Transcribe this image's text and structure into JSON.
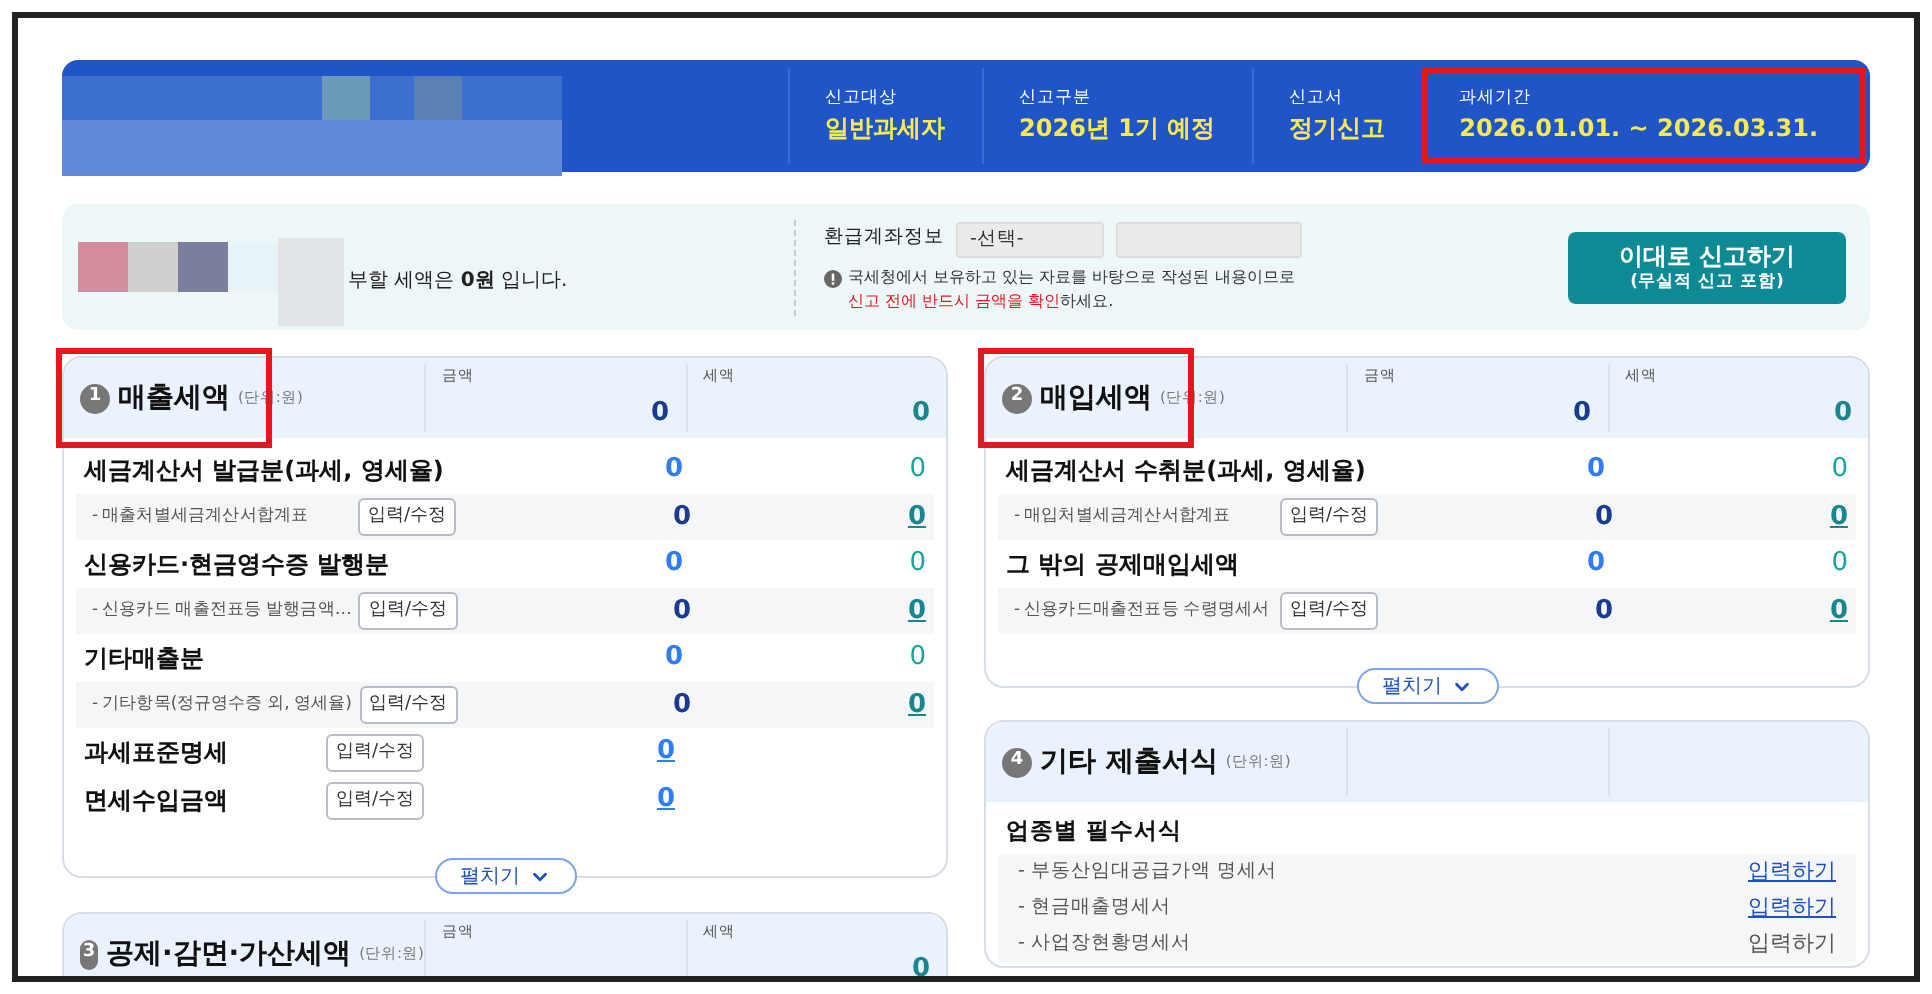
{
  "header": {
    "items": [
      {
        "label": "신고대상",
        "value": "일반과세자",
        "highlighted": false
      },
      {
        "label": "신고구분",
        "value": "2026년 1기 예정",
        "highlighted": false
      },
      {
        "label": "신고서",
        "value": "정기신고",
        "highlighted": false
      },
      {
        "label": "과세기간",
        "value": "2026.01.01. ~ 2026.03.31.",
        "highlighted": true
      }
    ]
  },
  "summary": {
    "message": "부할 세액은 **0원** 입니다.",
    "refund_label": "환급계좌정보",
    "bank_select": "-선택-",
    "notice_line1": "국세청에서 보유하고 있는 자료를 바탕으로 작성된 내용이므로",
    "notice_warning": "신고 전에 반드시 금액을 확인",
    "notice_tail": "하세요.",
    "submit_button": "이대로 신고하기",
    "submit_sub": "(무실적 신고 포함)"
  },
  "left_sections": [
    {
      "number": "1",
      "title": "매출세액",
      "unit": "(단위:원)",
      "highlighted": true,
      "amount_label": "금액",
      "amount": "0",
      "tax_label": "세액",
      "tax": "0",
      "expand_button": "펼치기",
      "rows": [
        {
          "kind": "main",
          "label": "세금계산서 발급분(과세, 영세율)",
          "amount": "0",
          "tax": "0"
        },
        {
          "kind": "sub",
          "label": "- 매출처별세금계산서합계표",
          "button": "입력/수정",
          "amount": "0",
          "tax": "0"
        },
        {
          "kind": "main",
          "label": "신용카드·현금영수증 발행분",
          "amount": "0",
          "tax": "0"
        },
        {
          "kind": "sub",
          "label": "- 신용카드 매출전표등 발행금액…",
          "button": "입력/수정",
          "amount": "0",
          "tax": "0"
        },
        {
          "kind": "main",
          "label": "기타매출분",
          "amount": "0",
          "tax": "0"
        },
        {
          "kind": "sub",
          "label": "- 기타항목(정규영수증 외, 영세율)",
          "button": "입력/수정",
          "amount": "0",
          "tax": "0"
        },
        {
          "kind": "form",
          "label": "과세표준명세",
          "button": "입력/수정",
          "amount": "0"
        },
        {
          "kind": "form",
          "label": "면세수입금액",
          "button": "입력/수정",
          "amount": "0"
        }
      ]
    },
    {
      "number": "3",
      "title": "공제·감면·가산세액",
      "unit": "(단위:원)",
      "highlighted": false,
      "amount_label": "금액",
      "tax_label": "세액",
      "tax": "0"
    }
  ],
  "right_sections": [
    {
      "number": "2",
      "title": "매입세액",
      "unit": "(단위:원)",
      "highlighted": true,
      "amount_label": "금액",
      "amount": "0",
      "tax_label": "세액",
      "tax": "0",
      "expand_button": "펼치기",
      "rows": [
        {
          "kind": "main",
          "label": "세금계산서 수취분(과세, 영세율)",
          "amount": "0",
          "tax": "0"
        },
        {
          "kind": "sub",
          "label": "- 매입처별세금계산서합계표",
          "button": "입력/수정",
          "amount": "0",
          "tax": "0"
        },
        {
          "kind": "main",
          "label": "그 밖의 공제매입세액",
          "amount": "0",
          "tax": "0"
        },
        {
          "kind": "sub",
          "label": "- 신용카드매출전표등 수령명세서",
          "button": "입력/수정",
          "amount": "0",
          "tax": "0"
        }
      ]
    },
    {
      "number": "4",
      "title": "기타 제출서식",
      "unit": "(단위:원)",
      "highlighted": false,
      "rows": [
        {
          "kind": "group",
          "label": "업종별 필수서식"
        },
        {
          "kind": "link",
          "label": "- 부동산임대공급가액 명세서",
          "action": "입력하기",
          "enabled": true
        },
        {
          "kind": "link",
          "label": "- 현금매출명세서",
          "action": "입력하기",
          "enabled": true
        },
        {
          "kind": "link",
          "label": "- 사업장현황명세서",
          "action": "입력하기",
          "enabled": false
        }
      ]
    }
  ]
}
